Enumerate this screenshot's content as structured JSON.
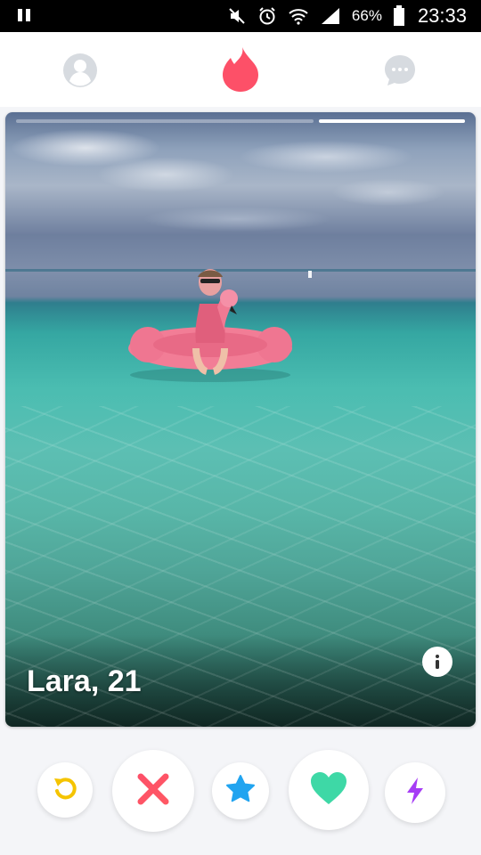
{
  "status_bar": {
    "battery_percent": "66%",
    "time": "23:33",
    "icons": [
      "pause-icon",
      "mute-icon",
      "alarm-icon",
      "wifi-icon",
      "signal-icon",
      "battery-icon"
    ]
  },
  "top_nav": {
    "icons": [
      "profile-icon",
      "flame-icon",
      "chat-icon"
    ],
    "active": "flame-icon",
    "colors": {
      "active": "#fd5068",
      "inactive": "#d7dbe0"
    }
  },
  "card": {
    "name_age": "Lara, 21",
    "photo_count": 2,
    "current_photo": 2,
    "info_icon": "info-icon"
  },
  "actions": [
    {
      "name": "rewind",
      "icon": "rewind-icon",
      "color": "#f5c400"
    },
    {
      "name": "nope",
      "icon": "x-icon",
      "color": "#fd5068"
    },
    {
      "name": "super-like",
      "icon": "star-icon",
      "color": "#21a4f0"
    },
    {
      "name": "like",
      "icon": "heart-icon",
      "color": "#3ed8a6"
    },
    {
      "name": "boost",
      "icon": "bolt-icon",
      "color": "#a63cf5"
    }
  ]
}
